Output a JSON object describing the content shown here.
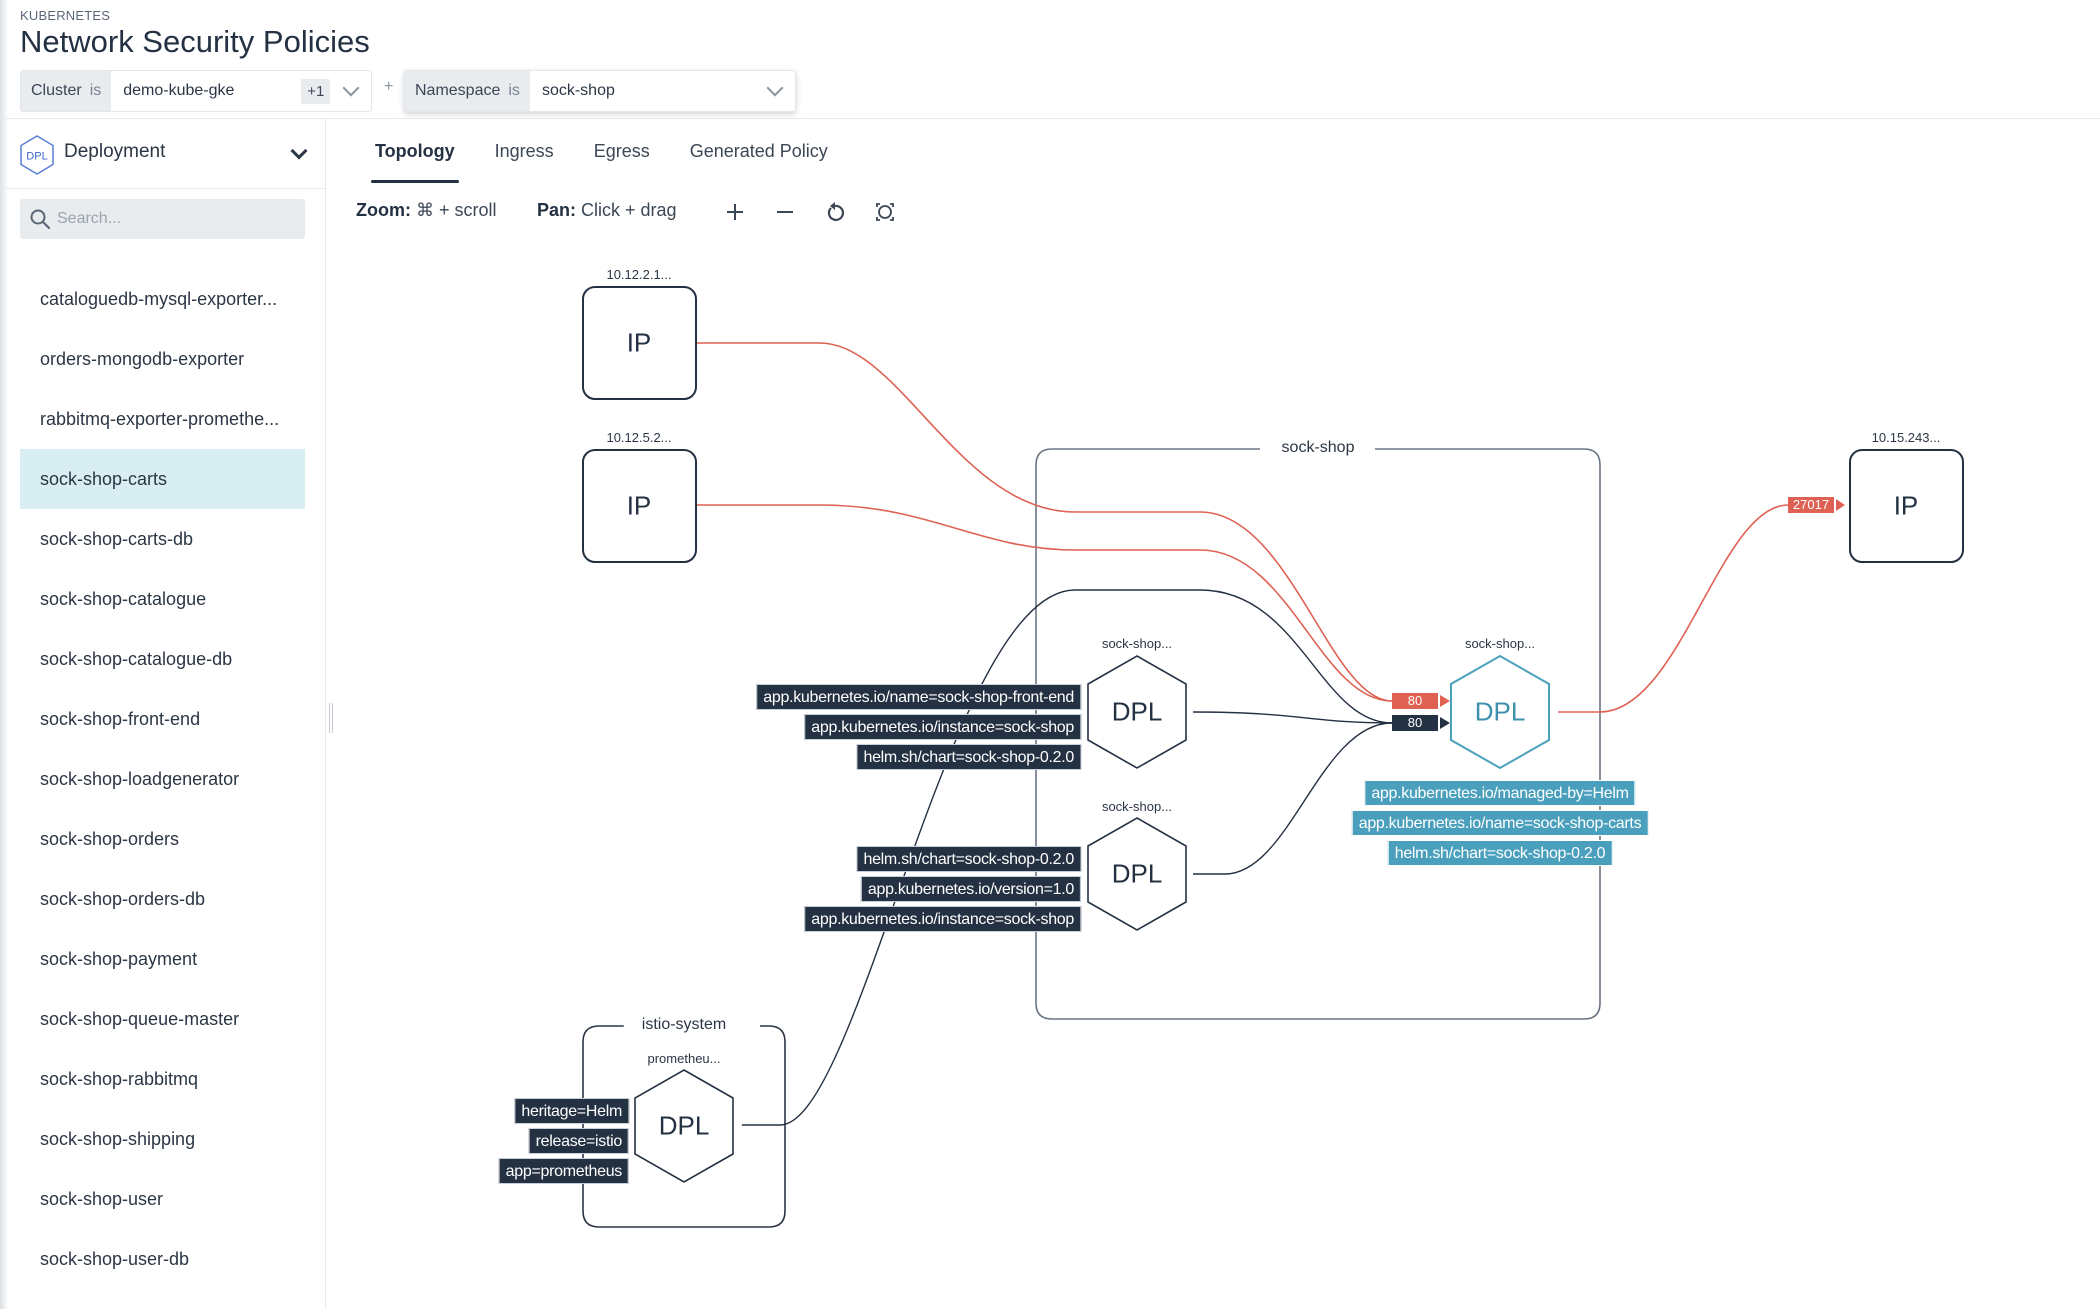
{
  "header": {
    "kicker": "KUBERNETES",
    "title": "Network Security Policies",
    "filters": [
      {
        "field": "Cluster",
        "op": "is",
        "value": "demo-kube-gke",
        "extra": "+1"
      },
      {
        "field": "Namespace",
        "op": "is",
        "value": "sock-shop"
      }
    ],
    "add_filter": "+"
  },
  "sidebar": {
    "type_icon": "DPL",
    "type_label": "Deployment",
    "search_placeholder": "Search...",
    "items": [
      {
        "label": "cataloguedb-mysql-exporter...",
        "selected": false
      },
      {
        "label": "orders-mongodb-exporter",
        "selected": false
      },
      {
        "label": "rabbitmq-exporter-promethe...",
        "selected": false
      },
      {
        "label": "sock-shop-carts",
        "selected": true
      },
      {
        "label": "sock-shop-carts-db",
        "selected": false
      },
      {
        "label": "sock-shop-catalogue",
        "selected": false
      },
      {
        "label": "sock-shop-catalogue-db",
        "selected": false
      },
      {
        "label": "sock-shop-front-end",
        "selected": false
      },
      {
        "label": "sock-shop-loadgenerator",
        "selected": false
      },
      {
        "label": "sock-shop-orders",
        "selected": false
      },
      {
        "label": "sock-shop-orders-db",
        "selected": false
      },
      {
        "label": "sock-shop-payment",
        "selected": false
      },
      {
        "label": "sock-shop-queue-master",
        "selected": false
      },
      {
        "label": "sock-shop-rabbitmq",
        "selected": false
      },
      {
        "label": "sock-shop-shipping",
        "selected": false
      },
      {
        "label": "sock-shop-user",
        "selected": false
      },
      {
        "label": "sock-shop-user-db",
        "selected": false
      }
    ]
  },
  "tabs": [
    {
      "label": "Topology",
      "active": true
    },
    {
      "label": "Ingress",
      "active": false
    },
    {
      "label": "Egress",
      "active": false
    },
    {
      "label": "Generated Policy",
      "active": false
    }
  ],
  "toolbar": {
    "zoom_key": "Zoom:",
    "zoom_hint": "⌘ + scroll",
    "pan_key": "Pan:",
    "pan_hint": "Click + drag",
    "icons": [
      "plus-icon",
      "minus-icon",
      "reset-icon",
      "fit-icon"
    ]
  },
  "topology": {
    "colors": {
      "allowed": "#de6153",
      "internal": "#243142",
      "selected": "#4a9fbc"
    },
    "ip_nodes": [
      {
        "id": "ip1",
        "label": "10.12.2.1...",
        "text": "IP"
      },
      {
        "id": "ip2",
        "label": "10.12.5.2...",
        "text": "IP"
      },
      {
        "id": "ip3",
        "label": "10.15.243...",
        "text": "IP"
      }
    ],
    "namespaces": [
      {
        "id": "ns-sock-shop",
        "label": "sock-shop"
      },
      {
        "id": "ns-istio",
        "label": "istio-system"
      }
    ],
    "deployments": [
      {
        "id": "front-end",
        "label": "sock-shop...",
        "text": "DPL",
        "tags": [
          "app.kubernetes.io/name=sock-shop-front-end",
          "app.kubernetes.io/instance=sock-shop",
          "helm.sh/chart=sock-shop-0.2.0"
        ]
      },
      {
        "id": "dpl2",
        "label": "sock-shop...",
        "text": "DPL",
        "tags": [
          "helm.sh/chart=sock-shop-0.2.0",
          "app.kubernetes.io/version=1.0",
          "app.kubernetes.io/instance=sock-shop"
        ]
      },
      {
        "id": "carts",
        "label": "sock-shop...",
        "text": "DPL",
        "selected": true,
        "tags": [
          "app.kubernetes.io/managed-by=Helm",
          "app.kubernetes.io/name=sock-shop-carts",
          "helm.sh/chart=sock-shop-0.2.0"
        ]
      },
      {
        "id": "prometheus",
        "label": "prometheu...",
        "text": "DPL",
        "tags": [
          "heritage=Helm",
          "release=istio",
          "app=prometheus"
        ]
      }
    ],
    "ports": {
      "ingress_external": "80",
      "ingress_internal": "80",
      "egress": "27017"
    }
  }
}
